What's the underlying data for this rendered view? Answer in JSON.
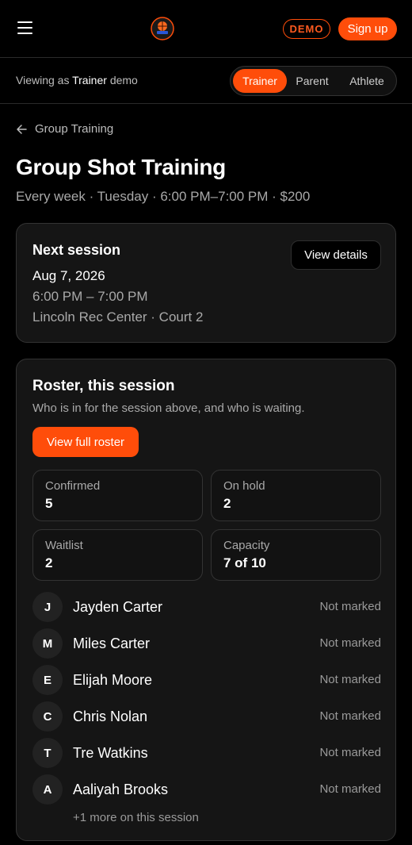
{
  "header": {
    "demo_badge": "DEMO",
    "signup_label": "Sign up",
    "accent": "#ff4d0a"
  },
  "viewing": {
    "prefix": "Viewing as",
    "role": "Trainer",
    "suffix": "demo",
    "roles": [
      "Trainer",
      "Parent",
      "Athlete"
    ],
    "active_role": "Trainer"
  },
  "page": {
    "back_label": "Group Training",
    "title": "Group Shot Training",
    "subtitle": "Every week · Tuesday · 6:00 PM–7:00 PM · $200"
  },
  "next_session": {
    "heading": "Next session",
    "date": "Aug 7, 2026",
    "time": "6:00 PM – 7:00 PM",
    "location": "Lincoln Rec Center · Court 2",
    "view_details_label": "View details"
  },
  "roster": {
    "heading": "Roster, this session",
    "description": "Who is in for the session above, and who is waiting.",
    "view_full_label": "View full roster",
    "stats": [
      {
        "label": "Confirmed",
        "value": "5"
      },
      {
        "label": "On hold",
        "value": "2"
      },
      {
        "label": "Waitlist",
        "value": "2"
      },
      {
        "label": "Capacity",
        "value": "7 of 10"
      }
    ],
    "players": [
      {
        "initial": "J",
        "name": "Jayden Carter",
        "status": "Not marked"
      },
      {
        "initial": "M",
        "name": "Miles Carter",
        "status": "Not marked"
      },
      {
        "initial": "E",
        "name": "Elijah Moore",
        "status": "Not marked"
      },
      {
        "initial": "C",
        "name": "Chris Nolan",
        "status": "Not marked"
      },
      {
        "initial": "T",
        "name": "Tre Watkins",
        "status": "Not marked"
      },
      {
        "initial": "A",
        "name": "Aaliyah Brooks",
        "status": "Not marked"
      }
    ],
    "more_label": "+1 more on this session"
  }
}
